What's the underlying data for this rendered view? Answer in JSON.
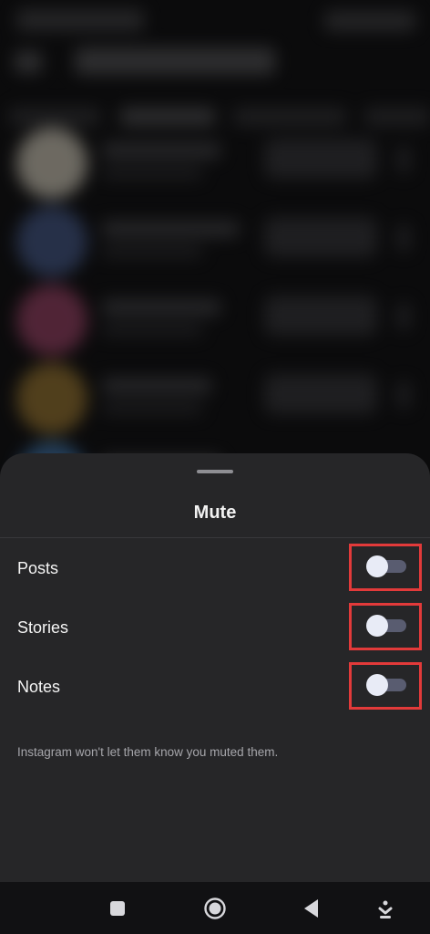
{
  "sheet": {
    "title": "Mute",
    "options": [
      {
        "label": "Posts",
        "enabled": false
      },
      {
        "label": "Stories",
        "enabled": false
      },
      {
        "label": "Notes",
        "enabled": false
      }
    ],
    "footnote": "Instagram won't let them know you muted them."
  },
  "highlight_color": "#e23a3a",
  "navbar": {
    "buttons": [
      "recents-icon",
      "home-icon",
      "back-icon",
      "keyboard-dismiss-icon"
    ]
  }
}
